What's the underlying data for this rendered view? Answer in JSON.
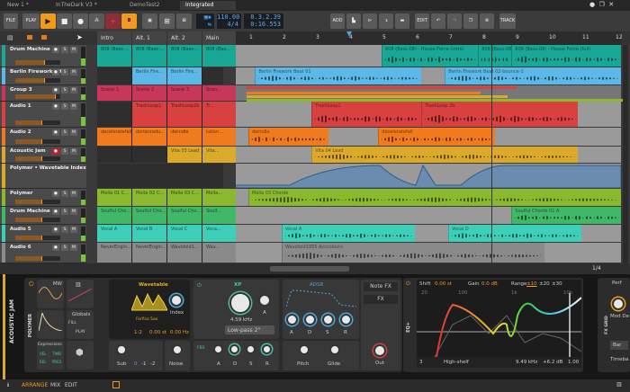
{
  "tabs": [
    "New 1 *",
    "InTheDark V3 *",
    "DemoTest2",
    "Integrated"
  ],
  "active_tab": 3,
  "toolbar": {
    "file": "FILE",
    "play": "PLAY",
    "add": "ADD",
    "edit": "EDIT",
    "track": "TRACK",
    "tempo": "110.00",
    "time_sig": "4/4",
    "position_bars": "8.3.2.39",
    "position_time": "0:16.553"
  },
  "colors": {
    "accent": "#f39a1e",
    "transport_lcd": "#64a6e6"
  },
  "ruler": [
    "1",
    "2",
    "3",
    "4",
    "5",
    "6",
    "7",
    "8",
    "9",
    "10",
    "11",
    "12"
  ],
  "playhead_bar": 4,
  "scenes": [
    "Intro",
    "Alt. 1",
    "Alt. 2",
    "Main"
  ],
  "tracks": [
    {
      "name": "Drum Machine",
      "color": "#1aa896",
      "h": 25,
      "vol": 0.65,
      "launch": [
        "808 (Bass-...",
        "808 (Bass-...",
        "808 (Bass-...",
        "808 (Bas..."
      ],
      "clips": [
        {
          "label": "808 (Bass-08) - House Force (intro)",
          "start": 5.0,
          "end": 7.9
        },
        {
          "label": "808 (Bass-08)",
          "start": 7.9,
          "end": 8.9
        },
        {
          "label": "808 (Bass-08) - House Force (full)",
          "start": 8.9,
          "end": 12.2
        }
      ]
    },
    {
      "name": "Berlin Firework Kit",
      "color": "#5cb8e6",
      "h": 20,
      "vol": 0.65,
      "launch": [
        "",
        "Berlin Fire...",
        "Berlin Fire...",
        ""
      ],
      "clips": [
        {
          "label": "Berlin Firework Beat 01",
          "start": 1.2,
          "end": 6.2
        },
        {
          "label": "Berlin Firework Beat 02-bounce-1",
          "start": 6.9,
          "end": 12.2
        }
      ]
    },
    {
      "name": "Group 3",
      "color": "#c8365a",
      "h": 18,
      "vol": 0.9,
      "launch": [
        "Scene 1",
        "Scene 2",
        "Scene 3",
        "Scen..."
      ],
      "clips": []
    },
    {
      "name": "Audio 1",
      "color": "#d94040",
      "h": 29,
      "vol": 0.6,
      "launch": [
        "",
        "TrashLoop1",
        "TrashLoop2b",
        "Tr..."
      ],
      "clips": [
        {
          "label": "TrashLoop1",
          "start": 2.9,
          "end": 6.2
        },
        {
          "label": "TrashLoop 2b",
          "start": 6.2,
          "end": 10.9
        }
      ]
    },
    {
      "name": "Audio 2",
      "color": "#f07a1e",
      "h": 21,
      "vol": 0.6,
      "launch": [
        "deceleratefall",
        "dorianredu...",
        "dwindle",
        "tallon..."
      ],
      "clips": [
        {
          "label": "dwindle",
          "start": 1.0,
          "end": 3.4
        },
        {
          "label": "deceleratefall",
          "start": 4.9,
          "end": 8.4
        }
      ]
    },
    {
      "name": "Acoustic Jam",
      "color": "#dcaa2a",
      "h": 19,
      "vol": 0.6,
      "launch": [
        "",
        "",
        "Vita 03 Lead",
        "Vita..."
      ],
      "clips": [
        {
          "label": "Vita 04 Lead",
          "start": 2.9,
          "end": 10.9
        }
      ]
    },
    {
      "name": "Polymer • Wavetable Index",
      "color": "#dcaa2a",
      "h": 28,
      "automation": true,
      "launch": [],
      "clips": []
    },
    {
      "name": "Polymer",
      "color": "#8ab82e",
      "h": 20,
      "vol": 0.6,
      "launch": [
        "Mella 01 C...",
        "Mella 02 C...",
        "Mella 03 C...",
        "Mella..."
      ],
      "clips": [
        {
          "label": "Mella 03 Chords",
          "start": 1.0,
          "end": 12.2
        }
      ]
    },
    {
      "name": "Drum Machine",
      "color": "#40b868",
      "h": 20,
      "vol": 0.6,
      "launch": [
        "Soulful Cho...",
        "Soulful Cho...",
        "Soulful Cho...",
        "Soulf..."
      ],
      "clips": [
        {
          "label": "Soulful Chords 01 A",
          "start": 8.9,
          "end": 12.2
        }
      ]
    },
    {
      "name": "Audio 5",
      "color": "#3ecfb8",
      "h": 20,
      "vol": 0.6,
      "launch": [
        "Vocal A",
        "Vocal B",
        "Vocal C",
        "Voca..."
      ],
      "clips": [
        {
          "label": "Vocal A",
          "start": 2.0,
          "end": 6.0
        },
        {
          "label": "Vocal D",
          "start": 7.0,
          "end": 11.0
        }
      ]
    },
    {
      "name": "Audio 6",
      "color": "#8a8a8a",
      "h": 23,
      "vol": 0.6,
      "launch": [
        "NeverEngin...",
        "NeverEngin...",
        "Wavoloid1...",
        "Wav..."
      ],
      "clips": [
        {
          "label": "Wavoloid1955 Acccolours",
          "start": 2.0,
          "end": 9.9
        }
      ]
    }
  ],
  "arranger_footer": {
    "grid": "1/4"
  },
  "device": {
    "track_label": "ACOUSTIC JAM",
    "instrument": "POLYMER",
    "mod": {
      "lfo": "MW",
      "globals": "Globals",
      "fill": "FILL",
      "play": "PLAY",
      "expressions": "Expressions",
      "vel": "VEL",
      "timb": "TIMB",
      "rel": "REL",
      "pres": "PRES"
    },
    "osc": {
      "title": "Wavetable",
      "wave": "Farfisa Sax",
      "index": "Index",
      "ratio": "1:2",
      "semi": "0.00 st",
      "hz": "0.00 Hz",
      "sub": "Sub",
      "noise": "Noise",
      "sub_oct": [
        "0",
        "-1",
        "-2"
      ]
    },
    "filter": {
      "title": "XP",
      "cutoff": "4.59 kHz",
      "mode": "Low-pass 2\"",
      "a": "A",
      "fbs": "FBS",
      "adsr": [
        "A",
        "D",
        "S",
        "R"
      ]
    },
    "env": {
      "title": "ADSR",
      "knobs": [
        "A",
        "D",
        "S",
        "R"
      ],
      "pitch": "Pitch",
      "glide": "Glide"
    },
    "fx": {
      "note_fx": "Note FX",
      "fx": "FX",
      "out": "Out"
    },
    "eq": {
      "label": "EQ+",
      "shift_label": "Shift",
      "shift": "0.00 st",
      "gain_label": "Gain",
      "gain": "0.0 dB",
      "range_label": "Range",
      "ranges": [
        "±10",
        "±20",
        "±30"
      ],
      "freqs": [
        "20",
        "100",
        "1k",
        "10k"
      ],
      "band": "3",
      "band_type": "High-shelf",
      "freq": "9.49 kHz",
      "band_gain": "+6.2 dB",
      "q": "1.00"
    },
    "fxgrid": {
      "label": "FX GRID",
      "title": "Perf",
      "mod": "Mod De",
      "bar": "Bar",
      "timebase": "Timeba"
    }
  },
  "bottom": {
    "arrange": "ARRANGE",
    "mix": "MIX",
    "edit": "EDIT"
  }
}
